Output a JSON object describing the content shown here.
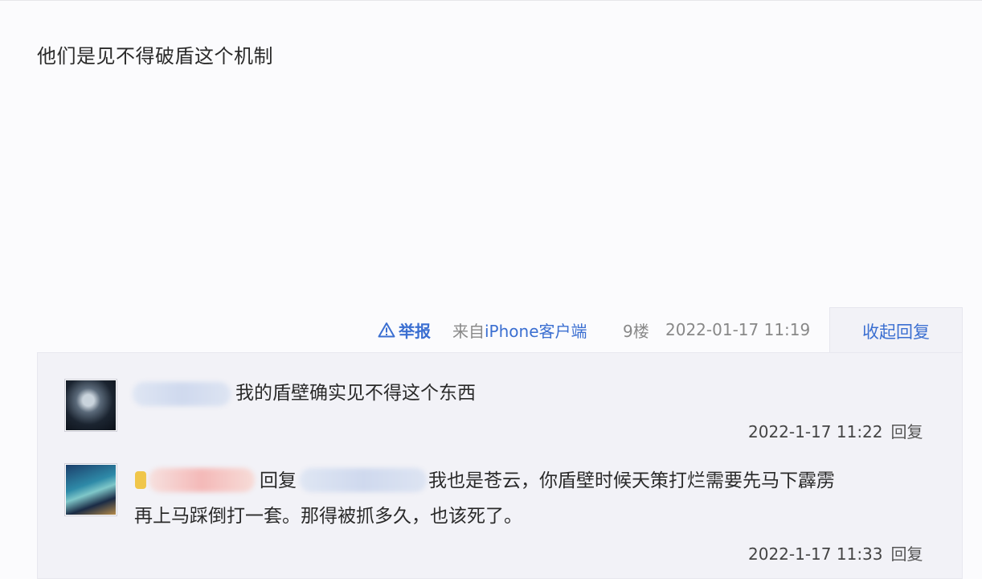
{
  "post": {
    "content": "他们是见不得破盾这个机制",
    "report_label": "举报",
    "client_prefix": "来自",
    "client_name": "iPhone客户端",
    "floor": "9楼",
    "time": "2022-01-17 11:19",
    "collapse_label": "收起回复"
  },
  "replies": [
    {
      "text": "我的盾壁确实见不得这个东西",
      "time": "2022-1-17 11:22",
      "reply_label": "回复"
    },
    {
      "reply_prefix": "回复",
      "text_line1": "我也是苍云，你盾壁时候天策打烂需要先马下霹雳",
      "text_line2": "再上马踩倒打一套。那得被抓多久，也该死了。",
      "time": "2022-1-17 11:33",
      "reply_label": "回复"
    }
  ],
  "colors": {
    "link": "#3b6fd1",
    "meta": "#888888",
    "reply_bg": "#f2f2f7"
  }
}
